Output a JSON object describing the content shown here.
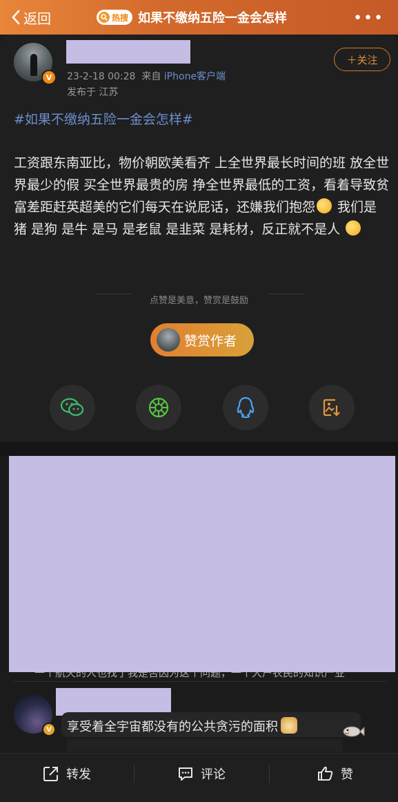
{
  "nav": {
    "back_label": "返回",
    "hot_badge": "热搜",
    "title": "如果不缴纳五险一金会怎样",
    "more_label": "•••"
  },
  "post": {
    "timestamp": "23-2-18 00:28",
    "source_prefix": "来自",
    "source": "iPhone客户端",
    "location": "发布于 江苏",
    "follow_label": "＋关注",
    "hashtag": "#如果不缴纳五险一金会怎样#",
    "body_part1": "工资跟东南亚比，物价朝欧美看齐 上全世界最长时间的班 放全世界最少的假 买全世界最贵的房 挣全世界最低的工资，看着导致贫富差距赶英超美的它们每天在说屁话，还嫌我们抱怨",
    "body_part2": " 我们是猪 是狗 是牛 是马 是老鼠 是韭菜 是耗材，反正就不是人 ",
    "reward_hint": "点赞是美意，赞赏是鼓励",
    "reward_label": "赞赏作者"
  },
  "share": {
    "items": [
      {
        "icon": "wechat-icon"
      },
      {
        "icon": "moments-icon"
      },
      {
        "icon": "qq-icon"
      },
      {
        "icon": "save-image-icon"
      }
    ]
  },
  "comments": {
    "faded_line": "一个航天的人也找了我是否因为这个问题，一个大户农民的知识产业",
    "items": [
      {
        "text": "享受着全宇宙都没有的公共贪污的面积"
      }
    ]
  },
  "bottom_bar": {
    "repost_label": "转发",
    "comment_label": "评论",
    "like_label": "赞"
  },
  "colors": {
    "accent_orange": "#e8863a",
    "link_blue": "#6d8ecd",
    "redaction": "#c5bde3",
    "background": "#1b1b1b"
  }
}
